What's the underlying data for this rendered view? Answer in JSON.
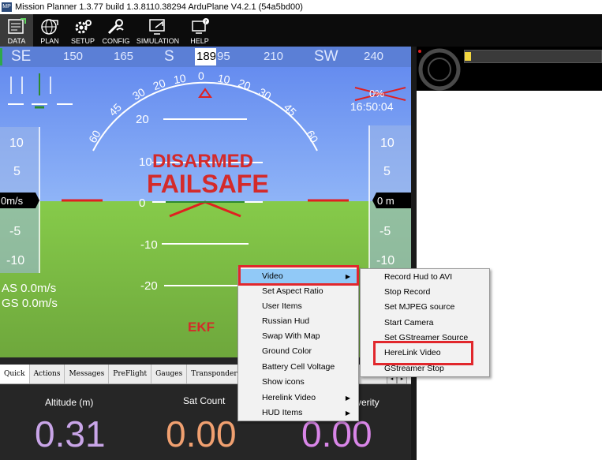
{
  "window": {
    "title": "Mission Planner 1.3.77 build 1.3.8110.38294 ArduPlane V4.2.1 (54a5bd00)",
    "icon_text": "MP"
  },
  "toolbar": {
    "items": [
      {
        "label": "DATA"
      },
      {
        "label": "PLAN"
      },
      {
        "label": "SETUP"
      },
      {
        "label": "CONFIG"
      },
      {
        "label": "SIMULATION"
      },
      {
        "label": "HELP"
      }
    ]
  },
  "hud": {
    "compass_ticks": [
      "SE",
      "150",
      "165",
      "S",
      "189",
      "95",
      "210",
      "SW",
      "240"
    ],
    "pitch_labels": [
      "20",
      "10",
      "0",
      "-10",
      "-20"
    ],
    "roll_labels": [
      "60",
      "45",
      "30",
      "20",
      "10",
      "0",
      "10",
      "20",
      "30",
      "45",
      "60"
    ],
    "battery": "0%",
    "time": "16:50:04",
    "status_disarmed": "DISARMED",
    "status_failsafe": "FAILSAFE",
    "ekf": "EKF",
    "speed_tape": [
      "10",
      "5",
      "-5",
      "-10"
    ],
    "speed_value": "0m/s",
    "alt_tape": [
      "10",
      "5",
      "-5",
      "-10"
    ],
    "alt_value": "0 m",
    "airspeed": "AS 0.0m/s",
    "groundspeed": "GS 0.0m/s",
    "colors": {
      "sky": "#6f9bf2",
      "ground": "#7ec045",
      "alert": "#d42a2a"
    }
  },
  "tabs": [
    "Quick",
    "Actions",
    "Messages",
    "PreFlight",
    "Gauges",
    "Transponder"
  ],
  "quick": {
    "items": [
      {
        "label": "Altitude (m)",
        "value": "0.31",
        "color": "#c9a5e8"
      },
      {
        "label": "Sat Count",
        "value": "0.00",
        "color": "#f0a070"
      },
      {
        "label": "verity",
        "value": "0.00",
        "color": "#d986e8"
      }
    ]
  },
  "context_menu": {
    "items": [
      {
        "label": "Video",
        "submenu": true
      },
      {
        "label": "Set Aspect Ratio",
        "submenu": false
      },
      {
        "label": "User Items",
        "submenu": false
      },
      {
        "label": "Russian Hud",
        "submenu": false
      },
      {
        "label": "Swap With Map",
        "submenu": false
      },
      {
        "label": "Ground Color",
        "submenu": false
      },
      {
        "label": "Battery Cell Voltage",
        "submenu": false
      },
      {
        "label": "Show icons",
        "submenu": false
      },
      {
        "label": "Herelink Video",
        "submenu": true
      },
      {
        "label": "HUD Items",
        "submenu": true
      }
    ]
  },
  "video_submenu": {
    "items": [
      {
        "label": "Record Hud to AVI"
      },
      {
        "label": "Stop Record"
      },
      {
        "label": "Set MJPEG source"
      },
      {
        "label": "Start Camera"
      },
      {
        "label": "Set GStreamer Source"
      },
      {
        "label": "HereLink Video"
      },
      {
        "label": "GStreamer Stop"
      }
    ]
  }
}
